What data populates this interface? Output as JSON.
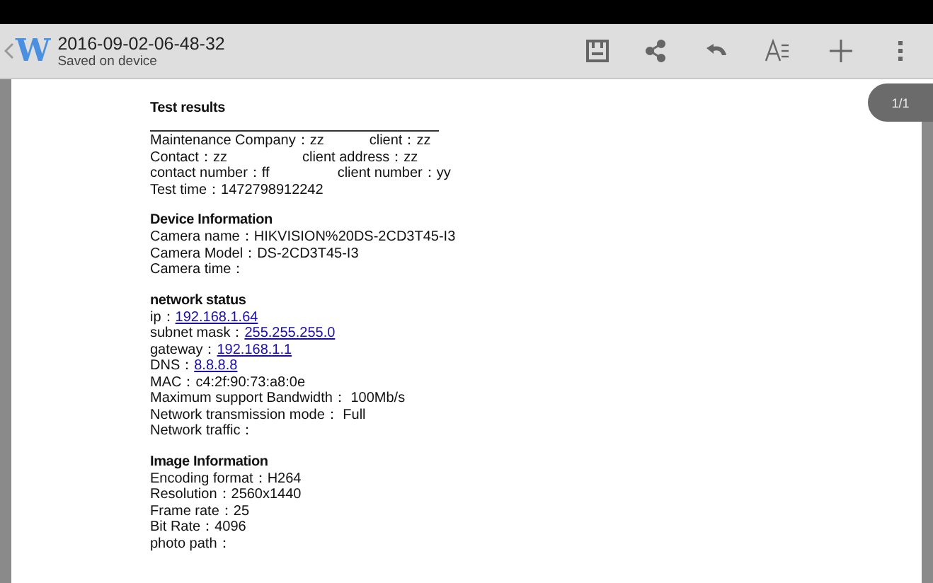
{
  "toolbar": {
    "title": "2016-09-02-06-48-32",
    "subtitle": "Saved on device",
    "logo": "W"
  },
  "page_indicator": "1/1",
  "document": {
    "sections": [
      {
        "title": "Test results",
        "ruled": true,
        "lines": [
          [
            {
              "kind": "text",
              "text": "Maintenance Company：zz"
            },
            {
              "kind": "text",
              "text": "client：zz"
            }
          ],
          [
            {
              "kind": "text",
              "text": "Contact：zz"
            },
            {
              "kind": "text",
              "text": "client address：zz"
            }
          ],
          [
            {
              "kind": "text",
              "text": "contact number：ff"
            },
            {
              "kind": "text",
              "text": "client number：yy"
            }
          ],
          [
            {
              "kind": "text",
              "text": "Test time：1472798912242"
            }
          ]
        ]
      },
      {
        "title": "Device Information",
        "lines": [
          [
            {
              "kind": "text",
              "text": "Camera name：HIKVISION%20DS-2CD3T45-I3"
            }
          ],
          [
            {
              "kind": "text",
              "text": "Camera Model：DS-2CD3T45-I3"
            }
          ],
          [
            {
              "kind": "text",
              "text": "Camera time："
            }
          ]
        ]
      },
      {
        "title": "network status",
        "lines": [
          [
            {
              "kind": "text",
              "text": "ip："
            },
            {
              "kind": "link",
              "text": "192.168.1.64"
            }
          ],
          [
            {
              "kind": "text",
              "text": "subnet mask："
            },
            {
              "kind": "link",
              "text": "255.255.255.0"
            }
          ],
          [
            {
              "kind": "text",
              "text": "gateway："
            },
            {
              "kind": "link",
              "text": "192.168.1.1"
            }
          ],
          [
            {
              "kind": "text",
              "text": "DNS："
            },
            {
              "kind": "link",
              "text": "8.8.8.8"
            }
          ],
          [
            {
              "kind": "text",
              "text": "MAC：c4:2f:90:73:a8:0e"
            }
          ],
          [
            {
              "kind": "text",
              "text": "Maximum support Bandwidth： 100Mb/s"
            }
          ],
          [
            {
              "kind": "text",
              "text": "Network transmission mode： Full"
            }
          ],
          [
            {
              "kind": "text",
              "text": "Network traffic："
            }
          ]
        ]
      },
      {
        "title": "Image Information",
        "lines": [
          [
            {
              "kind": "text",
              "text": "Encoding format：H264"
            }
          ],
          [
            {
              "kind": "text",
              "text": "Resolution：2560x1440"
            }
          ],
          [
            {
              "kind": "text",
              "text": "Frame rate：25"
            }
          ],
          [
            {
              "kind": "text",
              "text": "Bit Rate：4096"
            }
          ],
          [
            {
              "kind": "text",
              "text": "photo path："
            }
          ]
        ]
      }
    ]
  }
}
